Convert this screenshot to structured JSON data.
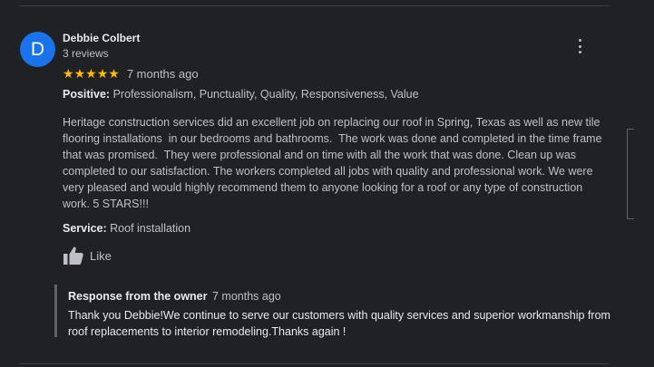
{
  "review": {
    "avatar_letter": "D",
    "author_name": "Debbie Colbert",
    "author_reviews": "3 reviews",
    "rating_stars": 5,
    "stars_text": "★★★★★",
    "time_ago": "7 months ago",
    "positive_label": "Positive:",
    "positive_values": "Professionalism, Punctuality, Quality, Responsiveness, Value",
    "text": "Heritage construction services did an excellent job on replacing our roof in Spring, Texas as well as new tile flooring installations  in our bedrooms and bathrooms.  The work was done and completed in the time frame that was promised.  They were professional and on time with all the work that was done. Clean up was completed to our satisfaction. The workers completed all jobs with quality and professional work. We were very pleased and would highly recommend them to anyone looking for a roof or any type of construction work. 5 STARS!!!",
    "service_label": "Service:",
    "service_value": "Roof installation",
    "like_label": "Like"
  },
  "owner_response": {
    "label": "Response from the owner",
    "time_ago": "7 months ago",
    "text": "Thank you Debbie!We continue to serve our customers with quality services and superior workmanship from roof replacements to interior remodeling.Thanks again !"
  },
  "colors": {
    "background": "#202124",
    "avatar": "#1a73e8",
    "star": "#fbbc04",
    "text_primary": "#e8eaed",
    "text_secondary": "#bdc1c6"
  },
  "icons": {
    "more": "more-vert-icon",
    "like": "thumb-up-icon",
    "star": "star-icon"
  }
}
